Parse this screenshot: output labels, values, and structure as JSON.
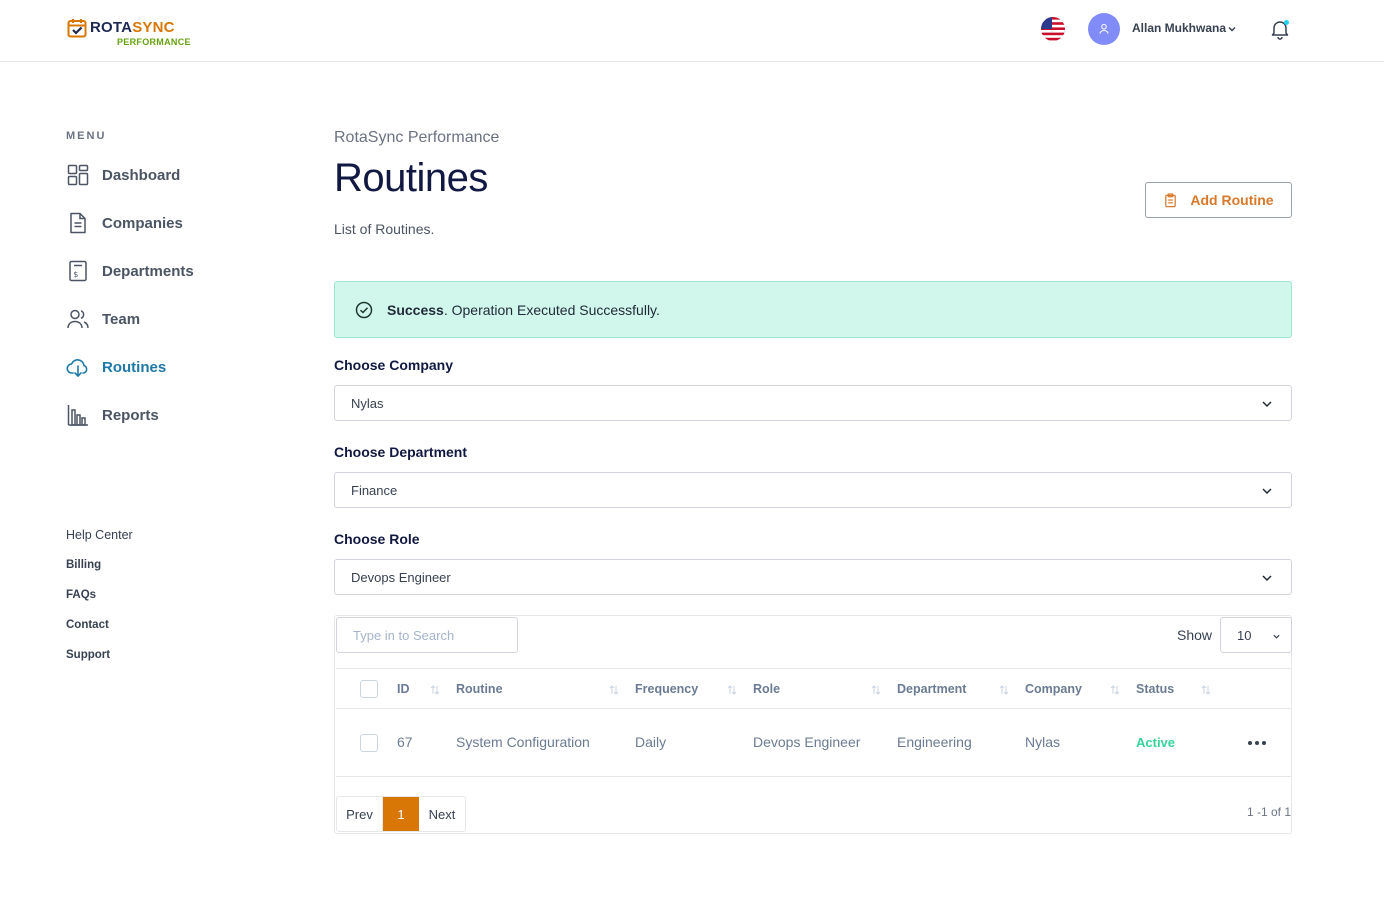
{
  "brand": {
    "name_part1": "ROTA",
    "name_part2": "SYNC",
    "tagline": "PERFORMANCE"
  },
  "header": {
    "user_name": "Allan Mukhwana"
  },
  "sidebar": {
    "menu_label": "MENU",
    "items": [
      {
        "label": "Dashboard",
        "icon": "grid-icon"
      },
      {
        "label": "Companies",
        "icon": "document-icon"
      },
      {
        "label": "Departments",
        "icon": "invoice-icon"
      },
      {
        "label": "Team",
        "icon": "users-icon"
      },
      {
        "label": "Routines",
        "icon": "cloud-download-icon",
        "active": true
      },
      {
        "label": "Reports",
        "icon": "bar-chart-icon"
      }
    ],
    "links": [
      "Help Center",
      "Billing",
      "FAQs",
      "Contact",
      "Support"
    ]
  },
  "main": {
    "breadcrumb": "RotaSync Performance",
    "title": "Routines",
    "subtitle": "List of Routines.",
    "add_button": "Add Routine",
    "alert": {
      "strong": "Success",
      "text": ". Operation Executed Successfully."
    },
    "filters": {
      "company": {
        "label": "Choose Company",
        "value": "Nylas"
      },
      "department": {
        "label": "Choose Department",
        "value": "Finance"
      },
      "role": {
        "label": "Choose Role",
        "value": "Devops Engineer"
      }
    },
    "table": {
      "search_placeholder": "Type in to Search",
      "show_label": "Show",
      "page_size": "10",
      "columns": [
        "ID",
        "Routine",
        "Frequency",
        "Role",
        "Department",
        "Company",
        "Status"
      ],
      "rows": [
        {
          "id": "67",
          "routine": "System Configuration",
          "frequency": "Daily",
          "role": "Devops Engineer",
          "department": "Engineering",
          "company": "Nylas",
          "status": "Active"
        }
      ],
      "pagination": {
        "prev": "Prev",
        "page": "1",
        "next": "Next",
        "range": "1 -1 of 1"
      }
    }
  },
  "colors": {
    "accent": "#d97706",
    "active_nav": "#1e78a8",
    "success_bg": "#d1f7ec",
    "status_active": "#34d399",
    "title": "#111842"
  }
}
